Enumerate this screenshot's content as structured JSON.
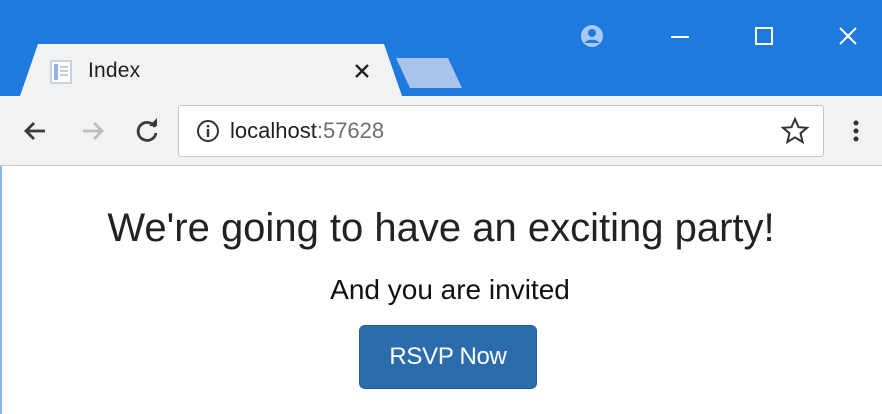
{
  "browser": {
    "tab": {
      "title": "Index"
    },
    "address_bar": {
      "host": "localhost",
      "port": ":57628"
    }
  },
  "page": {
    "heading": "We're going to have an exciting party!",
    "subheading": "And you are invited",
    "rsvp_button_label": "RSVP Now"
  },
  "icons": {
    "favicon": "page-icon",
    "tab_close": "close-icon",
    "new_tab": "new-tab",
    "profile": "profile-icon",
    "minimize": "minimize-icon",
    "maximize": "maximize-icon",
    "close_window": "close-icon",
    "back": "back-arrow-icon",
    "forward": "forward-arrow-icon",
    "reload": "reload-icon",
    "site_info": "info-icon",
    "bookmark": "star-icon",
    "menu": "kebab-menu-icon"
  },
  "colors": {
    "titlebar": "#1f7ae0",
    "toolbar": "#f2f2f2",
    "button": "#2b6cac"
  }
}
